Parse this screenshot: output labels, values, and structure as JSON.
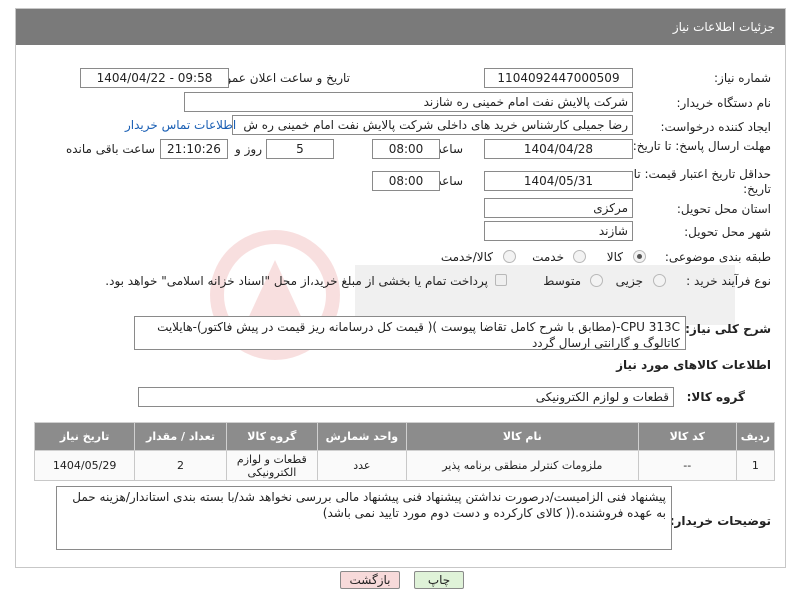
{
  "header": {
    "title": "جزئیات اطلاعات نیاز"
  },
  "fields": {
    "need_number": {
      "label": "شماره نیاز:",
      "value": "1104092447000509"
    },
    "announce_datetime": {
      "label": "تاریخ و ساعت اعلان عمومی:",
      "value": "1404/04/22 - 09:58"
    },
    "buyer_org": {
      "label": "نام دستگاه خریدار:",
      "value": "شرکت پالایش نفت امام خمینی  ره  شازند"
    },
    "requester": {
      "label": "ایجاد کننده درخواست:",
      "value": "رضا جمیلی کارشناس خرید های داخلی  شرکت پالایش نفت امام خمینی  ره  ش",
      "link": "اطلاعات تماس خریدار"
    },
    "reply_deadline": {
      "label": "مهلت ارسال پاسخ: تا تاریخ:",
      "date": "1404/04/28",
      "time_label": "ساعت",
      "time": "08:00",
      "days": "5",
      "days_label": "روز و",
      "remaining": "21:10:26",
      "remaining_label": "ساعت باقی مانده"
    },
    "price_validity": {
      "label": "حداقل تاریخ اعتبار قیمت: تا تاریخ:",
      "date": "1404/05/31",
      "time_label": "ساعت",
      "time": "08:00"
    },
    "province": {
      "label": "استان محل تحویل:",
      "value": "مرکزی"
    },
    "city": {
      "label": "شهر محل تحویل:",
      "value": "شازند"
    },
    "category": {
      "label": "طبقه بندی موضوعی:",
      "options": [
        "کالا",
        "خدمت",
        "کالا/خدمت"
      ],
      "selected": "کالا"
    },
    "purchase_process": {
      "label": "نوع فرآیند خرید :",
      "options": [
        "جزیی",
        "متوسط"
      ],
      "note": "پرداخت تمام یا بخشی از مبلغ خرید،از محل \"اسناد خزانه اسلامی\" خواهد بود."
    }
  },
  "description": {
    "label": "شرح کلی نیاز:",
    "text": "CPU 313C-(مطابق با شرح کامل تقاضا پیوست )( قیمت کل درسامانه ریز قیمت در پیش فاکتور)-هایلایت کاتالوگ و گارانتی ارسال گردد"
  },
  "goods_info": {
    "title": "اطلاعات کالاهای مورد نیاز",
    "group_label": "گروه کالا:",
    "group_value": "قطعات و لوازم الکترونیکی"
  },
  "table": {
    "headers": [
      "ردیف",
      "کد کالا",
      "نام کالا",
      "واحد شمارش",
      "گروه کالا",
      "تعداد / مقدار",
      "تاریخ نیاز"
    ],
    "rows": [
      [
        "1",
        "--",
        "ملزومات کنترلر منطقی برنامه پذیر",
        "عدد",
        "قطعات و لوازم الکترونیکی",
        "2",
        "1404/05/29"
      ]
    ]
  },
  "buyer_notes": {
    "label": "توضیحات خریدار:",
    "text": "پیشنهاد فنی الزامیست/درصورت نداشتن پیشنهاد فنی پیشنهاد مالی بررسی نخواهد شد/با بسته بندی استاندار/هزینه حمل به عهده فروشنده.(( کالای کارکرده و دست دوم مورد تایید نمی باشد)"
  },
  "buttons": {
    "print": "چاپ",
    "back": "بازگشت"
  },
  "colors": {
    "header_bg": "#7a7a7a",
    "table_header_bg": "#8c8c8c",
    "link": "#1a5fb4",
    "back_button_bg": "#f7dada",
    "print_button_bg": "#dff2d8"
  }
}
